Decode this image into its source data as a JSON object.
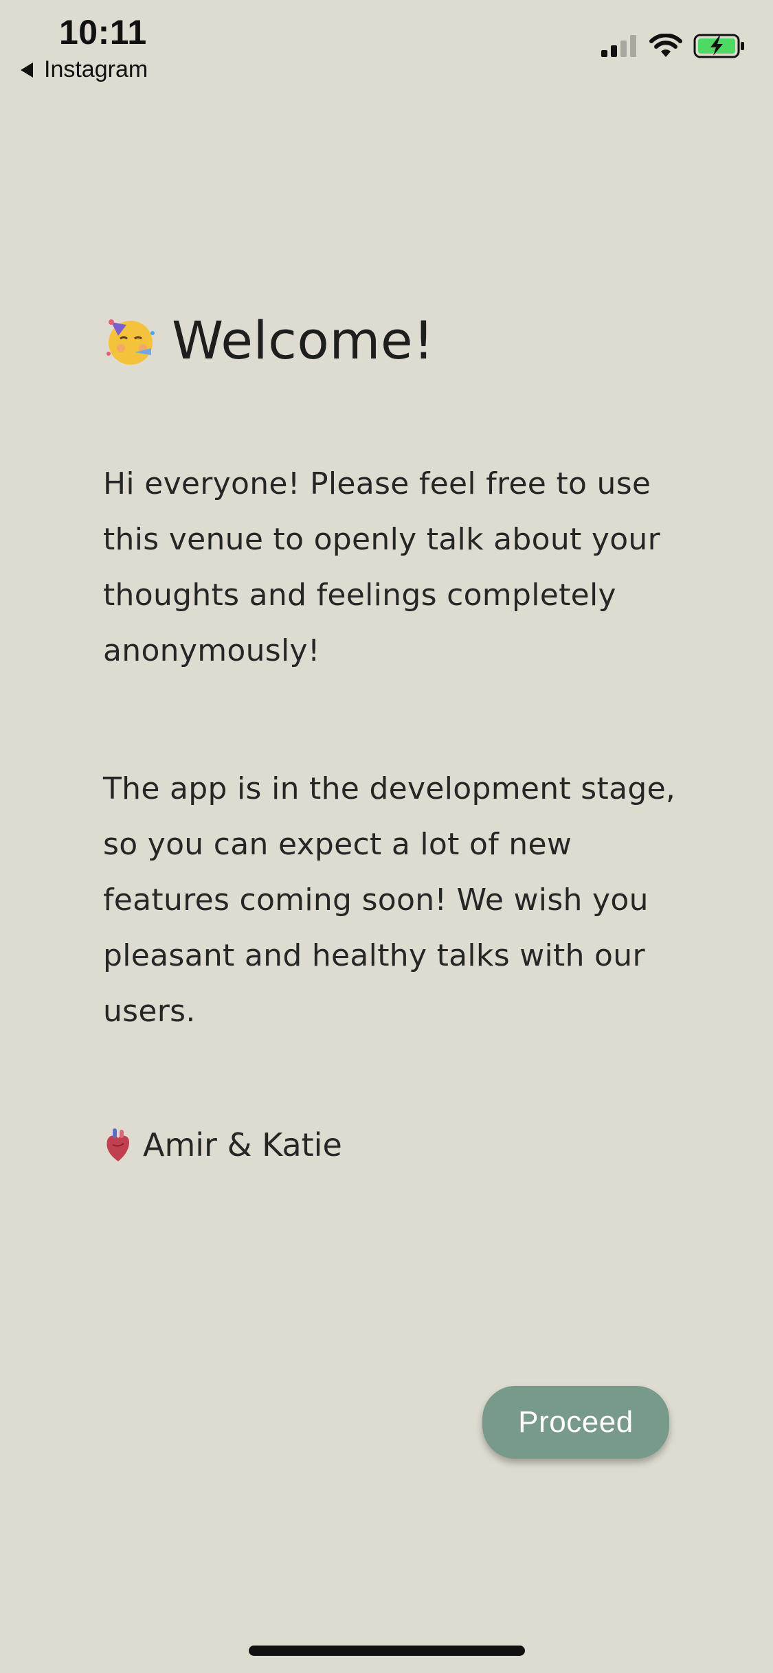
{
  "status_bar": {
    "time": "10:11",
    "back_app": "Instagram",
    "icons": [
      "cellular-signal-icon",
      "wifi-icon",
      "battery-charging-icon"
    ],
    "battery_color": "#4cd964"
  },
  "welcome": {
    "title": "Welcome!",
    "title_emoji": "partying-face-icon",
    "paragraph_1": "Hi everyone! Please feel free to use this venue to openly talk about your thoughts and feelings completely anonymously!",
    "paragraph_2": "The app is in the development stage, so you can expect a lot of new features coming soon! We wish you pleasant and healthy talks with our users.",
    "signature": "Amir & Katie",
    "signature_emoji": "anatomical-heart-icon"
  },
  "actions": {
    "proceed_label": "Proceed",
    "accent_color": "#779a8a"
  }
}
